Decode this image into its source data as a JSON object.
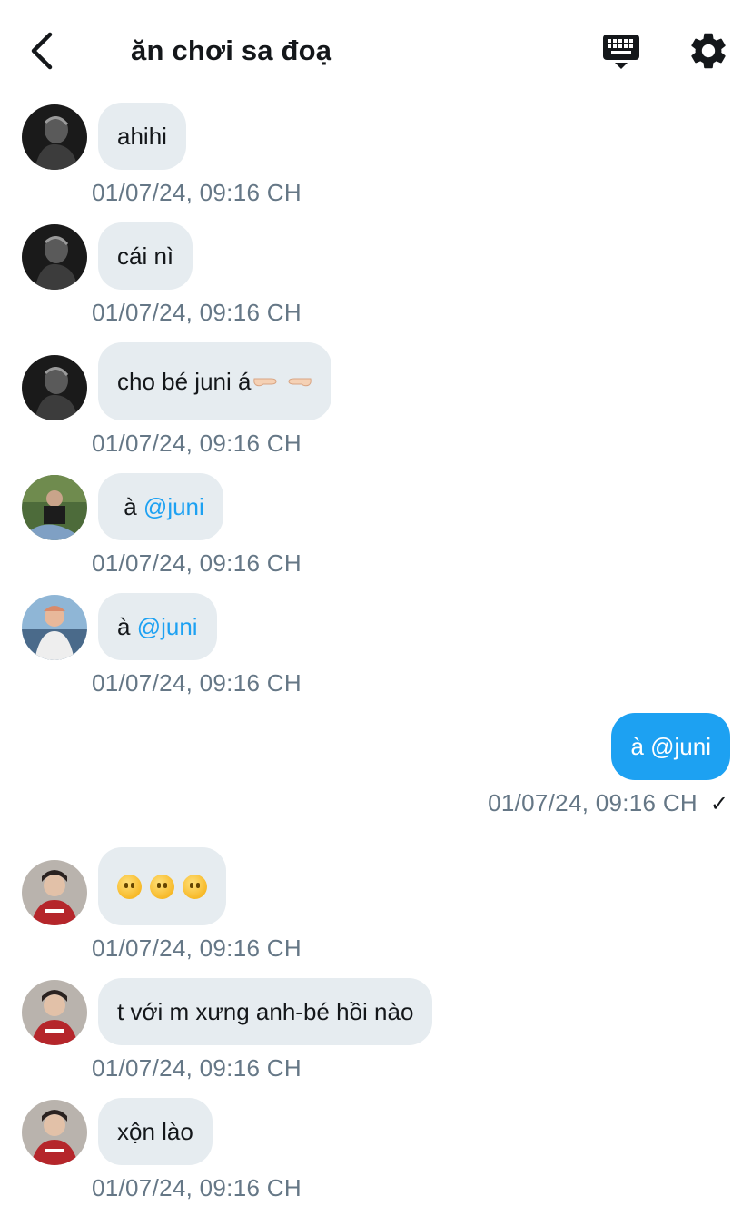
{
  "header": {
    "title": "ăn chơi sa đoạ"
  },
  "icons": {
    "back": "chevron-left-icon",
    "keyboard": "keyboard-icon",
    "settings": "gear-icon"
  },
  "colors": {
    "bubble_in": "#e6ecf0",
    "bubble_out": "#1da1f2",
    "mention": "#1da1f2",
    "timestamp": "#657786"
  },
  "messages": [
    {
      "direction": "in",
      "text": "ahihi",
      "time": "01/07/24, 09:16 CH"
    },
    {
      "direction": "in",
      "text": "cái nì",
      "time": "01/07/24, 09:16 CH"
    },
    {
      "direction": "in",
      "text": "cho bé juni á",
      "emoji": "pointing-hands",
      "time": "01/07/24, 09:16 CH"
    },
    {
      "direction": "in",
      "text": " à ",
      "mention": "@juni",
      "time": "01/07/24, 09:16 CH"
    },
    {
      "direction": "in",
      "text": "à ",
      "mention": "@juni",
      "time": "01/07/24, 09:16 CH"
    },
    {
      "direction": "out",
      "text": "à @juni",
      "time": "01/07/24, 09:16 CH",
      "status": "✓"
    },
    {
      "direction": "in",
      "emoji": "face-without-mouth x3",
      "time": "01/07/24, 09:16 CH"
    },
    {
      "direction": "in",
      "text": "t với m xưng anh-bé hồi nào",
      "time": "01/07/24, 09:16 CH"
    },
    {
      "direction": "in",
      "text": "xộn lào",
      "time": "01/07/24, 09:16 CH"
    }
  ]
}
